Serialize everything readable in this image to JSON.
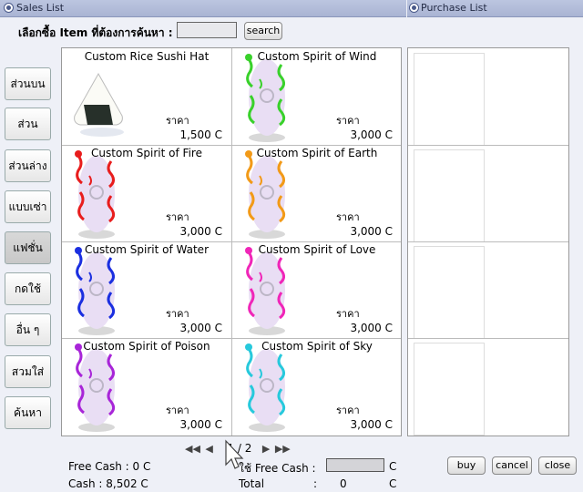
{
  "windows": {
    "sales_title": "Sales List",
    "purchase_title": "Purchase List"
  },
  "search": {
    "label": "เลือกซื้อ Item ที่ต้องการค้นหา :",
    "value": "",
    "button": "search"
  },
  "categories": [
    {
      "label": "ส่วนบน"
    },
    {
      "label": "ส่วนกลาง"
    },
    {
      "label": "ส่วนล่าง"
    },
    {
      "label": "แบบเซ่า"
    },
    {
      "label": "แฟชั่น"
    },
    {
      "label": "กดใช้งาน"
    },
    {
      "label": "อื่น ๆ"
    },
    {
      "label": "สวมใส่"
    },
    {
      "label": "ค้นหา"
    }
  ],
  "price_label": "ราคา",
  "items": [
    {
      "name": "Custom Rice Sushi Hat",
      "price": "1,500 C",
      "icon": "rice-ball-icon",
      "color": "#ffffff"
    },
    {
      "name": "Custom Spirit of Wind",
      "price": "3,000 C",
      "icon": "spirit-icon",
      "color": "#39d12b"
    },
    {
      "name": "Custom Spirit of Fire",
      "price": "3,000 C",
      "icon": "spirit-icon",
      "color": "#e81d1d"
    },
    {
      "name": "Custom Spirit of Earth",
      "price": "3,000 C",
      "icon": "spirit-icon",
      "color": "#f29a18"
    },
    {
      "name": "Custom Spirit of Water",
      "price": "3,000 C",
      "icon": "spirit-icon",
      "color": "#1b2fe0"
    },
    {
      "name": "Custom Spirit of Love",
      "price": "3,000 C",
      "icon": "spirit-icon",
      "color": "#f026b8"
    },
    {
      "name": "Custom Spirit of Poison",
      "price": "3,000 C",
      "icon": "spirit-icon",
      "color": "#a825d8"
    },
    {
      "name": "Custom Spirit of Sky",
      "price": "3,000 C",
      "icon": "spirit-icon",
      "color": "#27c9dc"
    }
  ],
  "pager": {
    "text": "1 / 2"
  },
  "footer": {
    "free_cash": "Free Cash : 0 C",
    "cash": "Cash : 8,502 C",
    "use_free_cash": "ใช้ Free Cash :",
    "use_unit": "C",
    "total_label": "Total",
    "total_colon": ":",
    "total_value": "0",
    "total_unit": "C"
  },
  "buttons": {
    "buy": "buy",
    "cancel": "cancel",
    "close": "close"
  }
}
